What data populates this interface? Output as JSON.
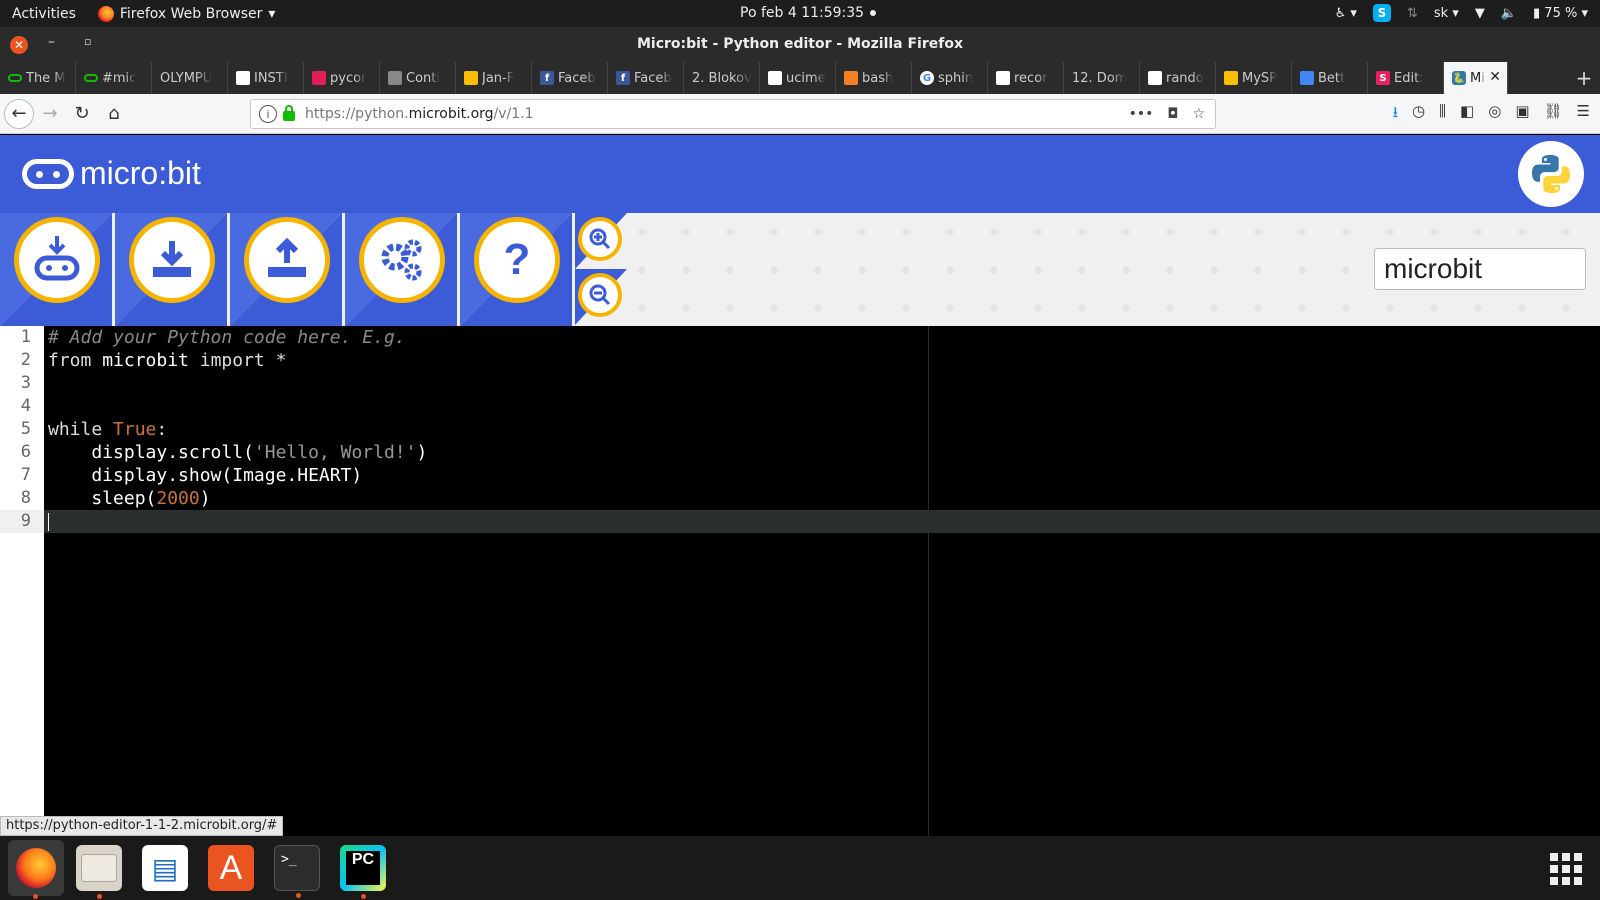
{
  "topbar": {
    "activities": "Activities",
    "app_menu": "Firefox Web Browser",
    "clock": "Po feb 4  11:59:35",
    "keyboard": "sk",
    "battery": "75 %"
  },
  "window": {
    "title": "Micro:bit - Python editor - Mozilla Firefox"
  },
  "tabs": [
    {
      "label": "The M",
      "icon": "link-icon",
      "color": "#12bc00"
    },
    {
      "label": "#mic",
      "icon": "link-icon",
      "color": "#12bc00"
    },
    {
      "label": "OLYMPU",
      "icon": "",
      "color": ""
    },
    {
      "label": "INŠTI",
      "icon": "grid-icon",
      "color": "#ffffff"
    },
    {
      "label": "pycor",
      "icon": "slack-icon",
      "color": "#e01e5a"
    },
    {
      "label": "Conti",
      "icon": "grid-icon",
      "color": "#888888"
    },
    {
      "label": "Jan-F",
      "icon": "drive-icon",
      "color": "#fbbc04"
    },
    {
      "label": "Faceb",
      "icon": "facebook-icon",
      "color": "#3b5998"
    },
    {
      "label": "Faceb",
      "icon": "facebook-icon",
      "color": "#3b5998"
    },
    {
      "label": "2. Blokov",
      "icon": "",
      "color": ""
    },
    {
      "label": "ucime",
      "icon": "github-icon",
      "color": "#ffffff"
    },
    {
      "label": "bash",
      "icon": "stackoverflow-icon",
      "color": "#f48024"
    },
    {
      "label": "sphin",
      "icon": "google-icon",
      "color": "#ffffff"
    },
    {
      "label": "recor",
      "icon": "box-icon",
      "color": "#ffffff"
    },
    {
      "label": "12. Dom",
      "icon": "",
      "color": ""
    },
    {
      "label": "rando",
      "icon": "book-icon",
      "color": "#ffffff"
    },
    {
      "label": "MySP",
      "icon": "drive-icon",
      "color": "#fbbc04"
    },
    {
      "label": "Bett",
      "icon": "docs-icon",
      "color": "#4285f4"
    },
    {
      "label": "Edit: ",
      "icon": "s-icon",
      "color": "#e91e63"
    }
  ],
  "active_tab": {
    "label": "Mi",
    "icon": "python-icon"
  },
  "url": {
    "prefix": "https://python.",
    "domain": "microbit.org",
    "path": "/v/1.1"
  },
  "header": {
    "logo_text": "micro:bit"
  },
  "toolbar": {
    "download_label": "Download",
    "save_label": "Save",
    "load_label": "Load",
    "snippets_label": "Snippets",
    "help_label": "Help",
    "script_name": "microbit"
  },
  "editor": {
    "current_line": 9,
    "line_numbers": [
      "1",
      "2",
      "3",
      "4",
      "5",
      "6",
      "7",
      "8",
      "9"
    ],
    "lines": [
      [
        {
          "t": "# Add your Python code here. E.g.",
          "c": "c-comment"
        }
      ],
      [
        {
          "t": "from ",
          "c": "c-kw"
        },
        {
          "t": "microbit",
          "c": "c-name"
        },
        {
          "t": " import *",
          "c": "c-kw"
        }
      ],
      [],
      [],
      [
        {
          "t": "while ",
          "c": "c-kw"
        },
        {
          "t": "True",
          "c": "c-const"
        },
        {
          "t": ":",
          "c": "c-kw"
        }
      ],
      [
        {
          "t": "    display.scroll(",
          "c": "c-name"
        },
        {
          "t": "'Hello, World!'",
          "c": "c-str"
        },
        {
          "t": ")",
          "c": "c-name"
        }
      ],
      [
        {
          "t": "    display.show(Image.HEART)",
          "c": "c-name"
        }
      ],
      [
        {
          "t": "    sleep(",
          "c": "c-name"
        },
        {
          "t": "2000",
          "c": "c-num"
        },
        {
          "t": ")",
          "c": "c-name"
        }
      ],
      [
        {
          "t": "",
          "c": "c-name"
        }
      ]
    ]
  },
  "status_link": "https://python-editor-1-1-2.microbit.org/#",
  "dock": [
    {
      "name": "firefox-icon",
      "running": true
    },
    {
      "name": "files-icon",
      "running": true
    },
    {
      "name": "writer-icon",
      "running": false
    },
    {
      "name": "software-center-icon",
      "running": false
    },
    {
      "name": "terminal-icon",
      "running": true
    },
    {
      "name": "pycharm-icon",
      "running": true
    }
  ]
}
